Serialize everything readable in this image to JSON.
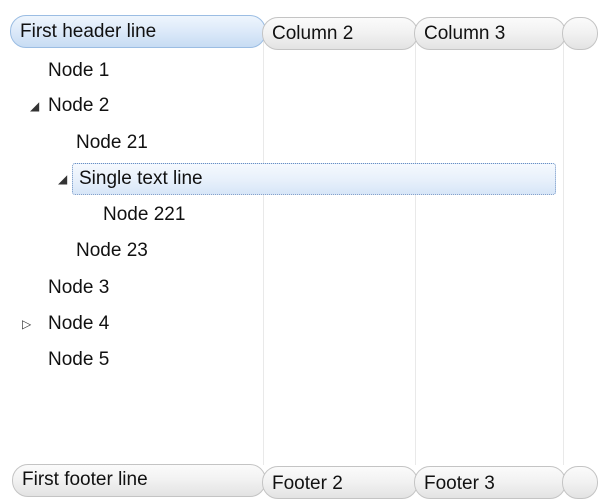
{
  "header": {
    "col1": "First header line",
    "col2": "Column 2",
    "col3": "Column 3",
    "col4": ""
  },
  "footer": {
    "col1": "First footer line",
    "col2": "Footer 2",
    "col3": "Footer 3",
    "col4": ""
  },
  "tree": {
    "node1": "Node 1",
    "node2": "Node 2",
    "node21": "Node 21",
    "selected": "Single text line",
    "node221": "Node 221",
    "node23": "Node 23",
    "node3": "Node 3",
    "node4": "Node 4",
    "node5": "Node 5"
  },
  "glyphs": {
    "expanded": "◢",
    "collapsed": "▷"
  },
  "colors": {
    "header_active": "#dce9f9",
    "selection": "#e7f0fb",
    "selection_border": "#6a8fc2"
  }
}
